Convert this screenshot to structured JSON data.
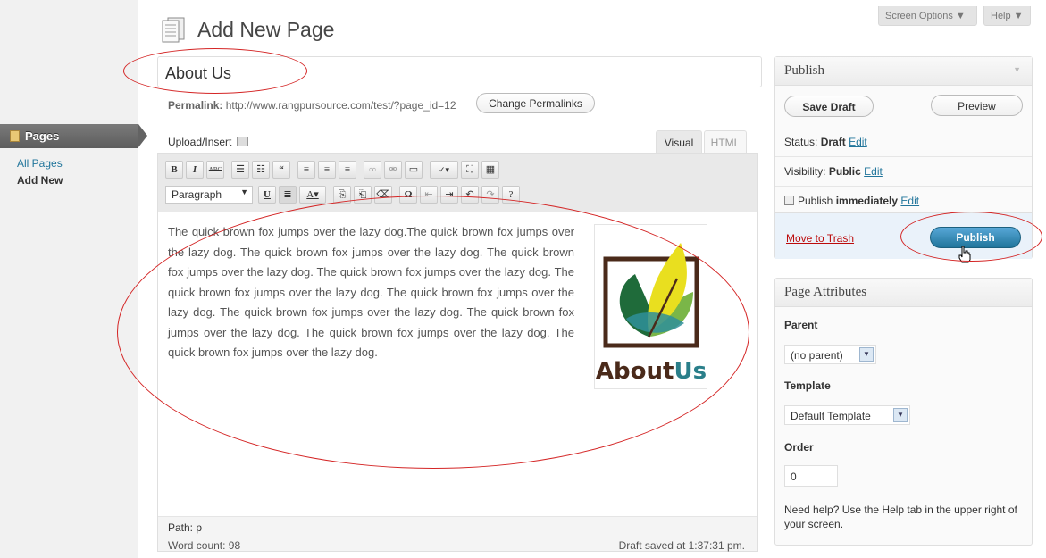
{
  "header": {
    "title": "Add New Page",
    "screen_options": "Screen Options ▼",
    "help": "Help ▼"
  },
  "sidebar": {
    "section": "Pages",
    "items": [
      {
        "label": "All Pages"
      },
      {
        "label": "Add New"
      }
    ]
  },
  "post": {
    "title": "About Us",
    "permalink_label": "Permalink:",
    "permalink_url": "http://www.rangpursource.com/test/?page_id=12",
    "change_permalinks": "Change Permalinks"
  },
  "editor": {
    "upload_insert": "Upload/Insert",
    "tab_visual": "Visual",
    "tab_html": "HTML",
    "format_select": "Paragraph",
    "content": "The quick brown fox jumps over the lazy dog.The quick brown fox jumps over the lazy dog. The quick brown fox jumps over the lazy dog. The quick brown fox jumps over the lazy dog. The quick brown fox jumps over the lazy dog. The quick brown fox jumps over the lazy dog. The quick brown fox jumps over the lazy dog. The quick brown fox jumps over the lazy dog. The quick brown fox jumps over the lazy dog. The quick brown fox jumps over the lazy dog. The quick brown fox jumps over the lazy dog.",
    "image_text": "AboutUs",
    "path": "Path: p",
    "word_count": "Word count: 98",
    "draft_saved": "Draft saved at 1:37:31 pm."
  },
  "publish_box": {
    "title": "Publish",
    "save_draft": "Save Draft",
    "preview": "Preview",
    "status_label": "Status:",
    "status_value": "Draft",
    "visibility_label": "Visibility:",
    "visibility_value": "Public",
    "publish_label": "Publish",
    "publish_value": "immediately",
    "edit": "Edit",
    "move_to_trash": "Move to Trash",
    "publish_button": "Publish"
  },
  "attributes_box": {
    "title": "Page Attributes",
    "parent_label": "Parent",
    "parent_value": "(no parent)",
    "template_label": "Template",
    "template_value": "Default Template",
    "order_label": "Order",
    "order_value": "0",
    "help_text": "Need help? Use the Help tab in the upper right of your screen."
  },
  "colors": {
    "link": "#21759b",
    "publish_button": "#21759b",
    "annotation": "#d42525",
    "trash": "#bc0b0b"
  },
  "icons": [
    "pages-icon",
    "page-title-icon",
    "upload-media-icon",
    "calendar-icon",
    "cursor-hand-icon"
  ]
}
